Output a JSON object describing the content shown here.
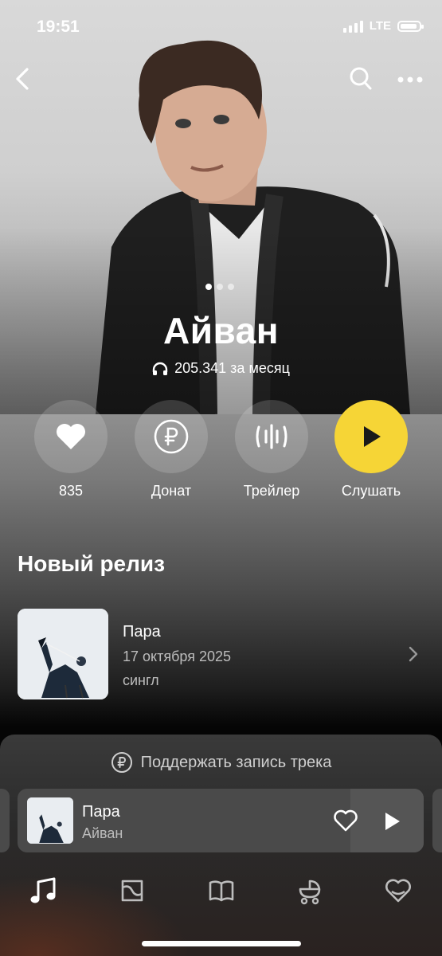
{
  "status_bar": {
    "time": "19:51",
    "network": "LTE"
  },
  "artist": {
    "name": "Айван",
    "listeners": "205.341 за месяц"
  },
  "actions": [
    {
      "label": "835",
      "icon": "heart-icon"
    },
    {
      "label": "Донат",
      "icon": "ruble-icon"
    },
    {
      "label": "Трейлер",
      "icon": "waveform-icon"
    },
    {
      "label": "Слушать",
      "icon": "play-icon"
    }
  ],
  "new_release": {
    "section_title": "Новый релиз",
    "title": "Пара",
    "date": "17 октября 2025",
    "type": "сингл"
  },
  "support": {
    "label": "Поддержать запись трека"
  },
  "player": {
    "title": "Пара",
    "artist": "Айван"
  },
  "tabs": [
    "music-note-icon",
    "map-icon",
    "book-icon",
    "stroller-icon",
    "heart-outline-icon"
  ],
  "colors": {
    "accent": "#f6d536",
    "background": "#000000",
    "muted_text": "#bdbdbd"
  }
}
